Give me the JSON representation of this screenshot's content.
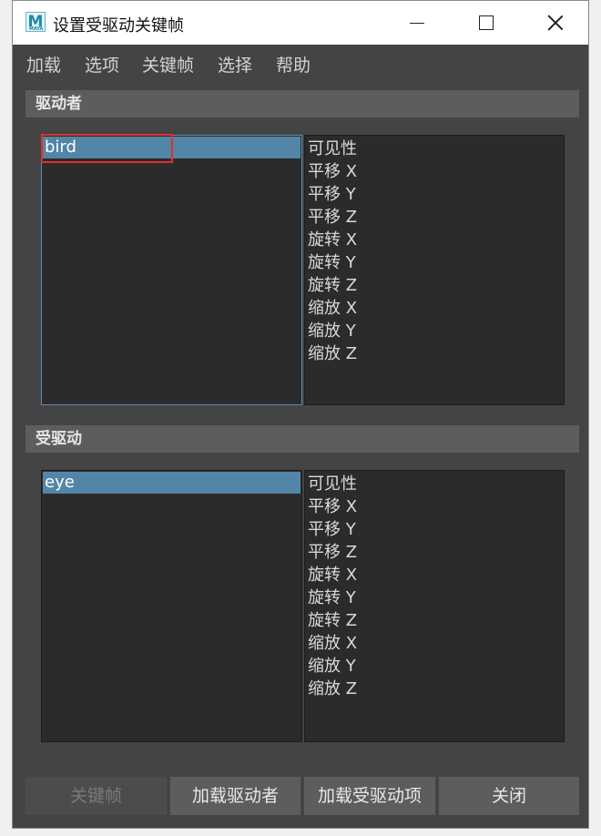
{
  "window": {
    "title": "设置受驱动关键帧",
    "app_icon_letter": "M",
    "app_icon_caption": "MAYA"
  },
  "menu": [
    "加载",
    "选项",
    "关键帧",
    "选择",
    "帮助"
  ],
  "driver": {
    "header": "驱动者",
    "objects": [
      "bird"
    ],
    "selected_object": "bird",
    "attributes": [
      "可见性",
      "平移 X",
      "平移 Y",
      "平移 Z",
      "旋转 X",
      "旋转 Y",
      "旋转 Z",
      "缩放 X",
      "缩放 Y",
      "缩放 Z"
    ]
  },
  "driven": {
    "header": "受驱动",
    "objects": [
      "eye"
    ],
    "selected_object": "eye",
    "attributes": [
      "可见性",
      "平移 X",
      "平移 Y",
      "平移 Z",
      "旋转 X",
      "旋转 Y",
      "旋转 Z",
      "缩放 X",
      "缩放 Y",
      "缩放 Z"
    ]
  },
  "buttons": {
    "key": "关键帧",
    "load_driver": "加载驱动者",
    "load_driven": "加载受驱动项",
    "close": "关闭"
  },
  "colors": {
    "panel_bg": "#444444",
    "list_bg": "#2b2b2b",
    "selection": "#5285a6",
    "highlight_outline": "#e03030"
  }
}
